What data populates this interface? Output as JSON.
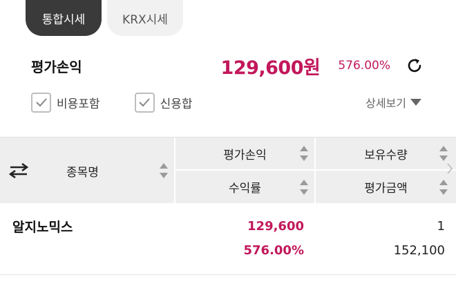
{
  "tabs": [
    {
      "label": "통합시세",
      "active": true
    },
    {
      "label": "KRX시세",
      "active": false
    }
  ],
  "summary": {
    "label": "평가손익",
    "amount": "129,600원",
    "rate": "576.00%"
  },
  "options": {
    "include_cost": "비용포함",
    "credit_sum": "신용합",
    "detail": "상세보기"
  },
  "table": {
    "headers": {
      "name": "종목명",
      "eval_pl": "평가손익",
      "holding_qty": "보유수량",
      "return_rate": "수익률",
      "eval_amount": "평가금액"
    },
    "rows": [
      {
        "name": "알지노믹스",
        "eval_pl": "129,600",
        "return_rate": "576.00%",
        "holding_qty": "1",
        "eval_amount": "152,100"
      }
    ]
  },
  "colors": {
    "accent_pink": "#c2185b",
    "active_tab": "#3a3a3a",
    "header_bg": "#eeeeee"
  }
}
